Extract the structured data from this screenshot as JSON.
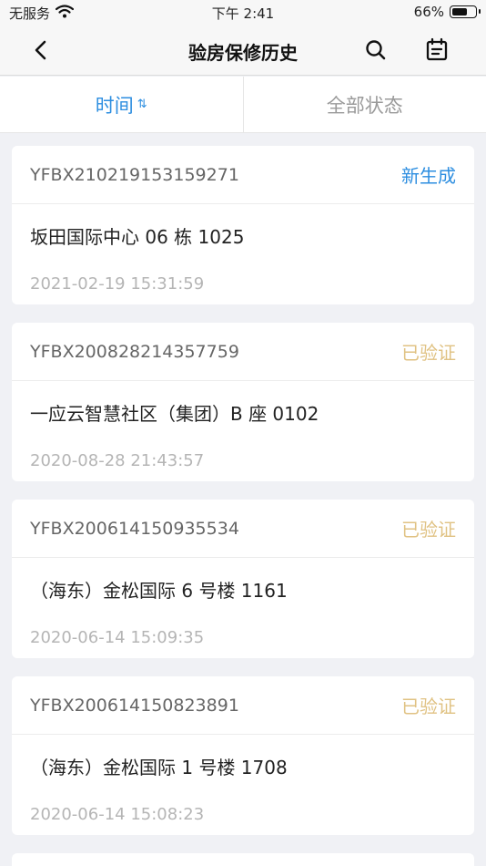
{
  "statusbar": {
    "carrier": "无服务",
    "time": "下午 2:41",
    "battery_percent": "66%",
    "battery_level": 0.66
  },
  "navbar": {
    "title": "验房保修历史"
  },
  "tabs": [
    {
      "label": "时间",
      "active": true
    },
    {
      "label": "全部状态",
      "active": false
    }
  ],
  "colors": {
    "accent": "#2d8ee0",
    "status_new": "#2d8ee0",
    "status_verified": "#e0c283"
  },
  "records": [
    {
      "order_no": "YFBX210219153159271",
      "status": "新生成",
      "status_type": "new",
      "address": "坂田国际中心 06 栋 1025",
      "datetime": "2021-02-19 15:31:59"
    },
    {
      "order_no": "YFBX200828214357759",
      "status": "已验证",
      "status_type": "verified",
      "address": "一应云智慧社区（集团）B 座 0102",
      "datetime": "2020-08-28 21:43:57"
    },
    {
      "order_no": "YFBX200614150935534",
      "status": "已验证",
      "status_type": "verified",
      "address": "（海东）金松国际 6 号楼 1161",
      "datetime": "2020-06-14 15:09:35"
    },
    {
      "order_no": "YFBX200614150823891",
      "status": "已验证",
      "status_type": "verified",
      "address": "（海东）金松国际 1 号楼 1708",
      "datetime": "2020-06-14 15:08:23"
    }
  ]
}
